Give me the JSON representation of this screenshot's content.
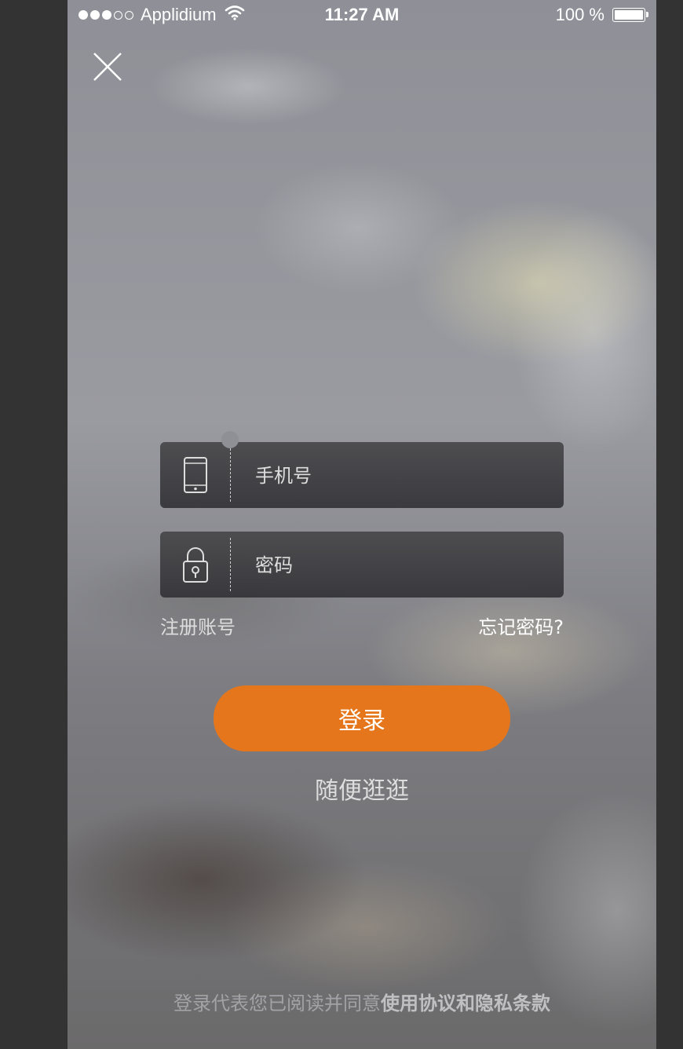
{
  "status_bar": {
    "carrier": "Applidium",
    "time": "11:27 AM",
    "battery": "100 %",
    "battery_level": 1.0
  },
  "close_button": {
    "icon": "close-icon"
  },
  "phone_field": {
    "placeholder": "手机号",
    "icon": "mobile-phone-icon"
  },
  "password_field": {
    "placeholder": "密码",
    "icon": "lock-icon"
  },
  "links": {
    "register": "注册账号",
    "forgot_password": "忘记密码?"
  },
  "login_button": {
    "label": "登录"
  },
  "browse_link": "随便逛逛",
  "agreement": {
    "prefix": "登录代表您已阅读并同意",
    "terms": "使用协议",
    "and": "和",
    "privacy": "隐私条款"
  },
  "colors": {
    "login_fill": "#e6761c",
    "input_text": "#dddddd",
    "forgot_text": "#ffffff"
  }
}
